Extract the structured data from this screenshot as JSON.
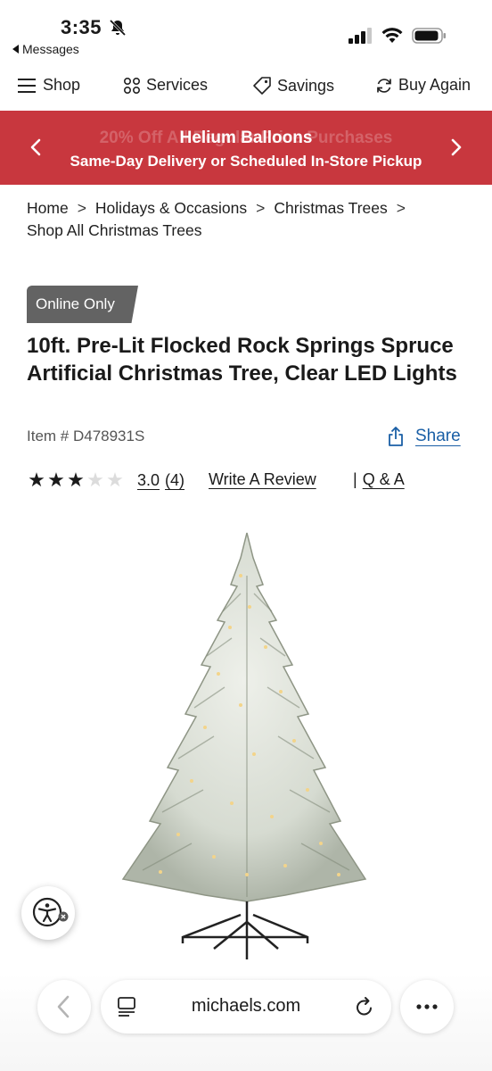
{
  "status_bar": {
    "time": "3:35",
    "back_app_label": "Messages"
  },
  "nav": {
    "items": [
      {
        "label": "Shop",
        "icon": "menu-icon"
      },
      {
        "label": "Services",
        "icon": "grid-icon"
      },
      {
        "label": "Savings",
        "icon": "tag-icon"
      },
      {
        "label": "Buy Again",
        "icon": "refresh-icon"
      }
    ]
  },
  "promo": {
    "ghost_text": "20% Off All Regular Price Purchases",
    "title": "Helium Balloons",
    "subtitle": "Same-Day Delivery or Scheduled In-Store Pickup",
    "background_color": "#c8373e"
  },
  "breadcrumb": {
    "items": [
      "Home",
      "Holidays & Occasions",
      "Christmas Trees",
      "Shop All Christmas Trees"
    ],
    "separator": ">"
  },
  "product": {
    "badge": "Online Only",
    "title": "10ft. Pre-Lit Flocked Rock Springs Spruce Artificial Christmas Tree, Clear LED Lights",
    "item_number": "Item # D478931S",
    "share_label": "Share",
    "rating_value": "3.0",
    "rating_count": "(4)",
    "rating_stars": 3,
    "rating_max": 5,
    "write_review_label": "Write A Review",
    "qa_separator": "|",
    "qa_label": "Q & A"
  },
  "browser": {
    "url": "michaels.com"
  }
}
